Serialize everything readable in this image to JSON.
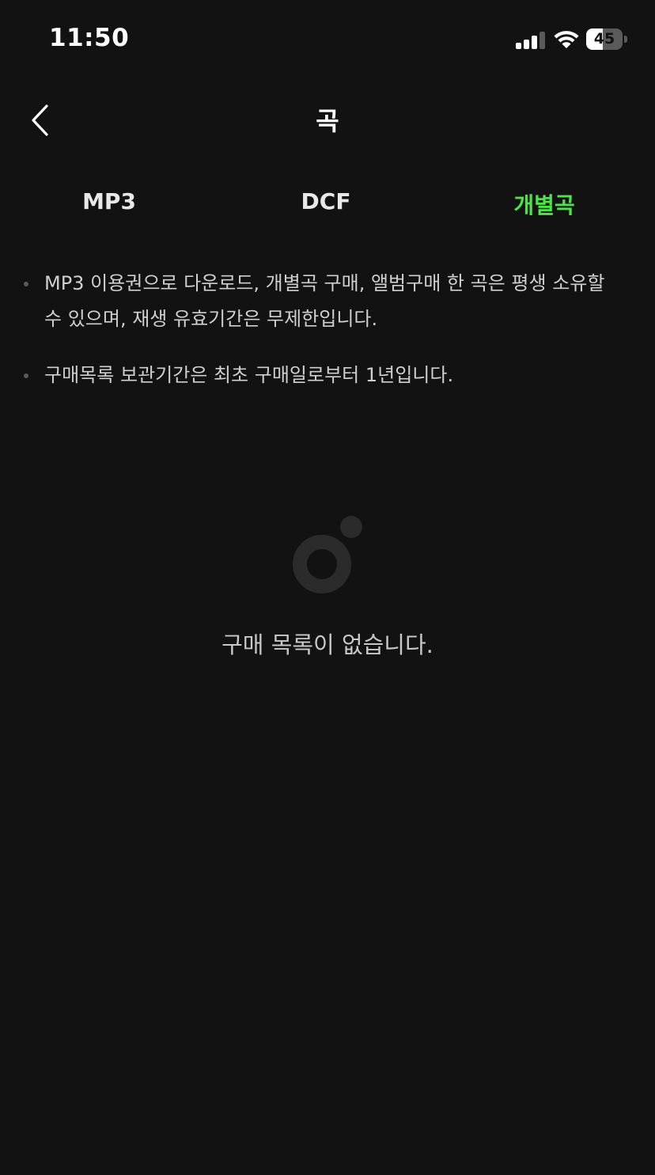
{
  "status_bar": {
    "time": "11:50",
    "battery": "45",
    "battery_level": 0.45,
    "icons": [
      "signal-icon",
      "wifi-icon",
      "battery-icon"
    ]
  },
  "header": {
    "title": "곡",
    "back_icon": "chevron-left-icon"
  },
  "tabs": [
    {
      "label": "MP3",
      "active": false
    },
    {
      "label": "DCF",
      "active": false
    },
    {
      "label": "개별곡",
      "active": true
    }
  ],
  "notices": [
    "MP3 이용권으로 다운로드, 개별곡 구매, 앨범구매 한 곡은 평생 소유할 수 있으며, 재생 유효기간은 무제한입니다.",
    "구매목록 보관기간은 최초 구매일로부터 1년입니다."
  ],
  "empty_state": {
    "icon": "empty-music-icon",
    "message": "구매 목록이 없습니다."
  },
  "colors": {
    "background": "#121212",
    "accent": "#4ee34b",
    "text": "#cfcfcf"
  }
}
